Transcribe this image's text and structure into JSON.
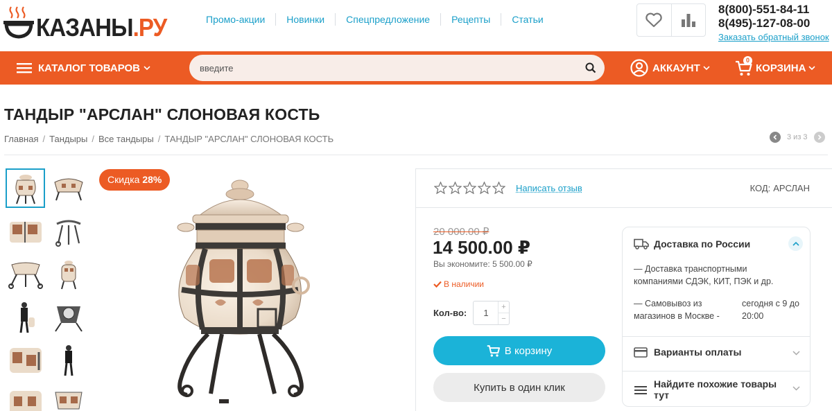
{
  "logo": {
    "main": "КАЗАНЫ",
    "suffix": ".РУ"
  },
  "topnav": [
    "Промо-акции",
    "Новинки",
    "Спецпредложение",
    "Рецепты",
    "Статьи"
  ],
  "header_icons": [
    "heart-icon",
    "compare-bars-icon"
  ],
  "contacts": {
    "phone1": "8(800)-551-84-11",
    "phone2": "8(495)-127-08-00",
    "callback": "Заказать обратный звонок"
  },
  "bar": {
    "catalog": "КАТАЛОГ ТОВАРОВ",
    "search_placeholder": "введите",
    "account": "АККАУНТ",
    "cart": "КОРЗИНА",
    "cart_count": "0"
  },
  "product": {
    "title": "ТАНДЫР \"АРСЛАН\" СЛОНОВАЯ КОСТЬ",
    "breadcrumbs": [
      "Главная",
      "Тандыры",
      "Все тандыры",
      "ТАНДЫР \"АРСЛАН\" СЛОНОВАЯ КОСТЬ"
    ],
    "pager": "3 из 3",
    "sale_label": "Скидка",
    "sale_value": "28%",
    "rating_stars": 0,
    "review_link": "Написать отзыв",
    "code_label": "КОД:",
    "code_value": "АРСЛАН",
    "old_price": "20 000.00 ₽",
    "price": "14 500.00 ₽",
    "savings": "Вы экономите: 5 500.00 ₽",
    "stock": "В наличии",
    "qty_label": "Кол-во:",
    "qty": "1",
    "add_to_cart": "В корзину",
    "one_click": "Купить в один клик"
  },
  "delivery": {
    "title": "Доставка по России",
    "text": "— Доставка транспортными компаниями СДЭК, КИТ, ПЭК и др.",
    "pickup_left": "— Самовывоз из магазинов в Москве -",
    "pickup_right": "сегодня с 9 до 20:00",
    "payment": "Варианты оплаты",
    "similar": "Найдите похожие товары тут"
  },
  "colors": {
    "accent": "#ec5b24",
    "link": "#1a9fc9",
    "button": "#1bb3d8"
  }
}
